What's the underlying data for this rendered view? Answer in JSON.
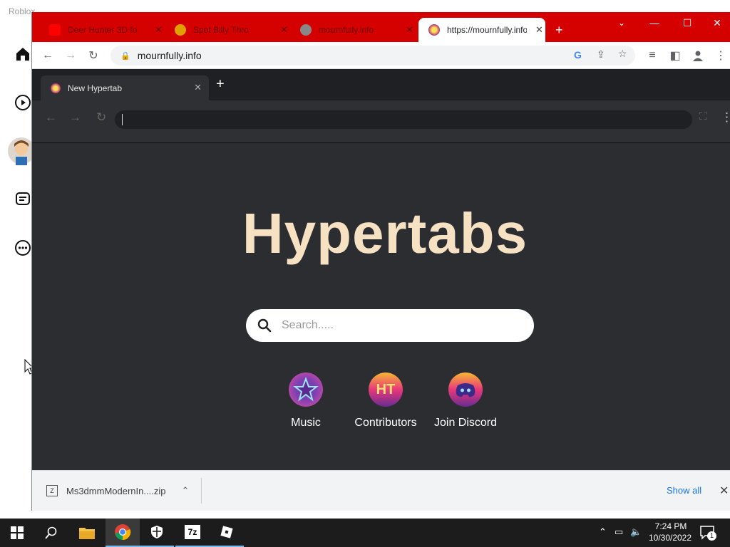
{
  "roblox": {
    "title": "Roblox"
  },
  "chrome": {
    "tabs": [
      {
        "label": "Deer Hunter 3D fo",
        "active": false
      },
      {
        "label": "Spot Billy Thro",
        "active": false
      },
      {
        "label": "mournfully.info",
        "active": false
      },
      {
        "label": "https://mournfully.info",
        "active": true
      }
    ],
    "omnibox": {
      "url": "mournfully.info"
    },
    "window": {
      "minimize": "—",
      "maximize": "☐",
      "close": "✕"
    }
  },
  "page": {
    "tab_title": "New Hypertab",
    "hero": "Hypertabs",
    "search_placeholder": "Search.....",
    "tiles": [
      {
        "label": "Music",
        "icon": "star-icon"
      },
      {
        "label": "Contributors",
        "icon": "ht-logo-icon"
      },
      {
        "label": "Join Discord",
        "icon": "discord-icon"
      }
    ]
  },
  "downloads": {
    "file": "Ms3dmmModernIn....zip",
    "show_all": "Show all"
  },
  "taskbar": {
    "time": "7:24 PM",
    "date": "10/30/2022",
    "notifications": "1"
  },
  "colors": {
    "tabstrip": "#d50000",
    "page_bg": "#2b2d31",
    "hero": "#f7e1c3"
  }
}
